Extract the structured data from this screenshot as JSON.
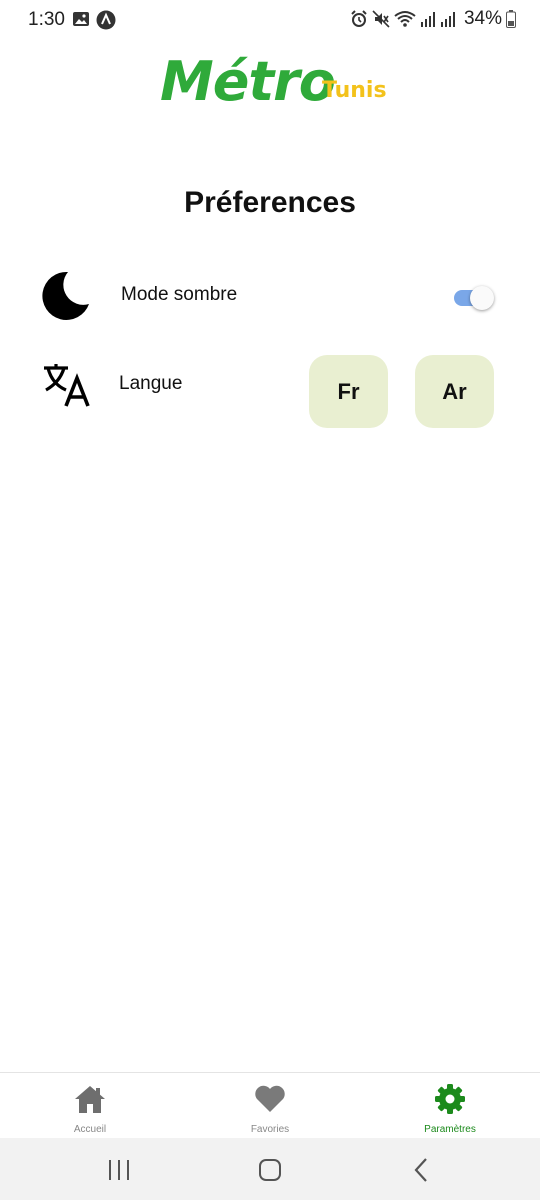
{
  "status_bar": {
    "time": "1:30",
    "battery_text": "34%",
    "left_icons": [
      "image-icon",
      "app-notification-icon"
    ],
    "right_icons": [
      "alarm-icon",
      "mute-icon",
      "wifi-icon",
      "signal-icon",
      "signal-icon",
      "battery-icon"
    ]
  },
  "header": {
    "logo_main": "Métro",
    "logo_sub": "Tunis",
    "logo_colors": {
      "main": "#2faa3a",
      "sub": "#f3c21b"
    }
  },
  "page": {
    "title": "Préferences"
  },
  "preferences": {
    "dark_mode": {
      "label": "Mode sombre",
      "icon": "moon-icon",
      "enabled": true,
      "accent": "#7aa7e8"
    },
    "language": {
      "label": "Langue",
      "icon": "translate-icon",
      "options": [
        "Fr",
        "Ar"
      ],
      "button_color": "#e9efd1"
    }
  },
  "tab_bar": {
    "active_color": "#1c8a1c",
    "tabs": [
      {
        "label": "Accueil",
        "icon": "home-icon",
        "active": false
      },
      {
        "label": "Favories",
        "icon": "heart-icon",
        "active": false
      },
      {
        "label": "Paramètres",
        "icon": "gear-icon",
        "active": true
      }
    ]
  },
  "system_nav": {
    "buttons": [
      "recent-apps-icon",
      "home-circle-icon",
      "back-icon"
    ]
  }
}
